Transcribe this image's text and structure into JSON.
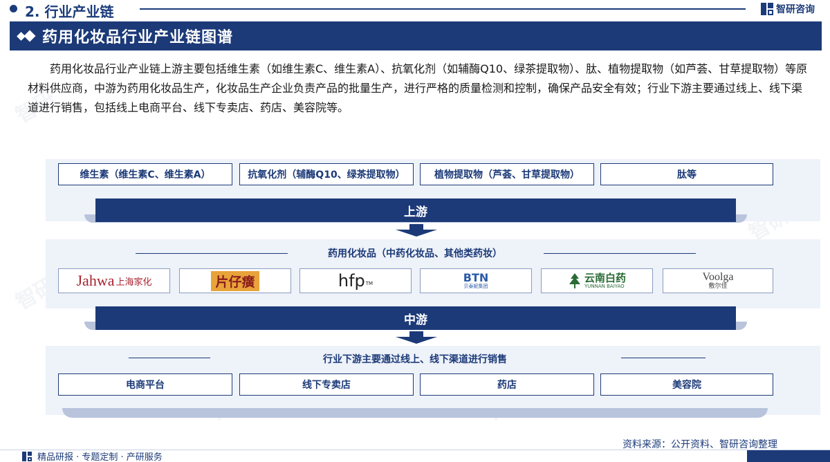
{
  "header": {
    "section_title": "2. 行业产业链",
    "brand": "智研咨询"
  },
  "title_bar": {
    "title": "药用化妆品行业产业链图谱"
  },
  "intro": "药用化妆品行业产业链上游主要包括维生素（如维生素C、维生素A）、抗氧化剂（如辅酶Q10、绿茶提取物）、肽、植物提取物（如芦荟、甘草提取物）等原材料供应商，中游为药用化妆品生产，化妆品生产企业负责产品的批量生产，进行严格的质量检测和控制，确保产品安全有效；行业下游主要通过线上、线下渠道进行销售，包括线上电商平台、线下专卖店、药店、美容院等。",
  "upstream": {
    "items": [
      "维生素（维生素C、维生素A）",
      "抗氧化剂（辅酶Q10、绿茶提取物）",
      "植物提取物（芦荟、甘草提取物）",
      "肽等"
    ],
    "label": "上游"
  },
  "midstream": {
    "title": "药用化妆品（中药化妆品、其他类药妆）",
    "label": "中游",
    "logos": [
      {
        "text": "Jahwa",
        "sub": "上海家化"
      },
      {
        "text": "片仔癀",
        "sub": ""
      },
      {
        "text": "hfp",
        "sub": "TM"
      },
      {
        "text": "BTN",
        "sub": "贝泰妮集团"
      },
      {
        "text": "云南白药",
        "sub": "YUNNAN BAIYAO"
      },
      {
        "text": "Voolga",
        "sub": "敷尔佳"
      }
    ]
  },
  "downstream": {
    "title": "行业下游主要通过线上、线下渠道进行销售",
    "items": [
      "电商平台",
      "线下专卖店",
      "药店",
      "美容院"
    ]
  },
  "footer": {
    "source": "资料来源：公开资料、智研咨询整理",
    "left": "精品研报 · 专题定制 · 产研服务"
  },
  "colors": {
    "primary": "#1c3a78",
    "panel": "#eef2f9",
    "jahwa_red": "#a8232f",
    "pzh_orange": "#e8a33a",
    "btn_blue": "#2b5ba8",
    "ynby_green": "#2a6b35"
  }
}
